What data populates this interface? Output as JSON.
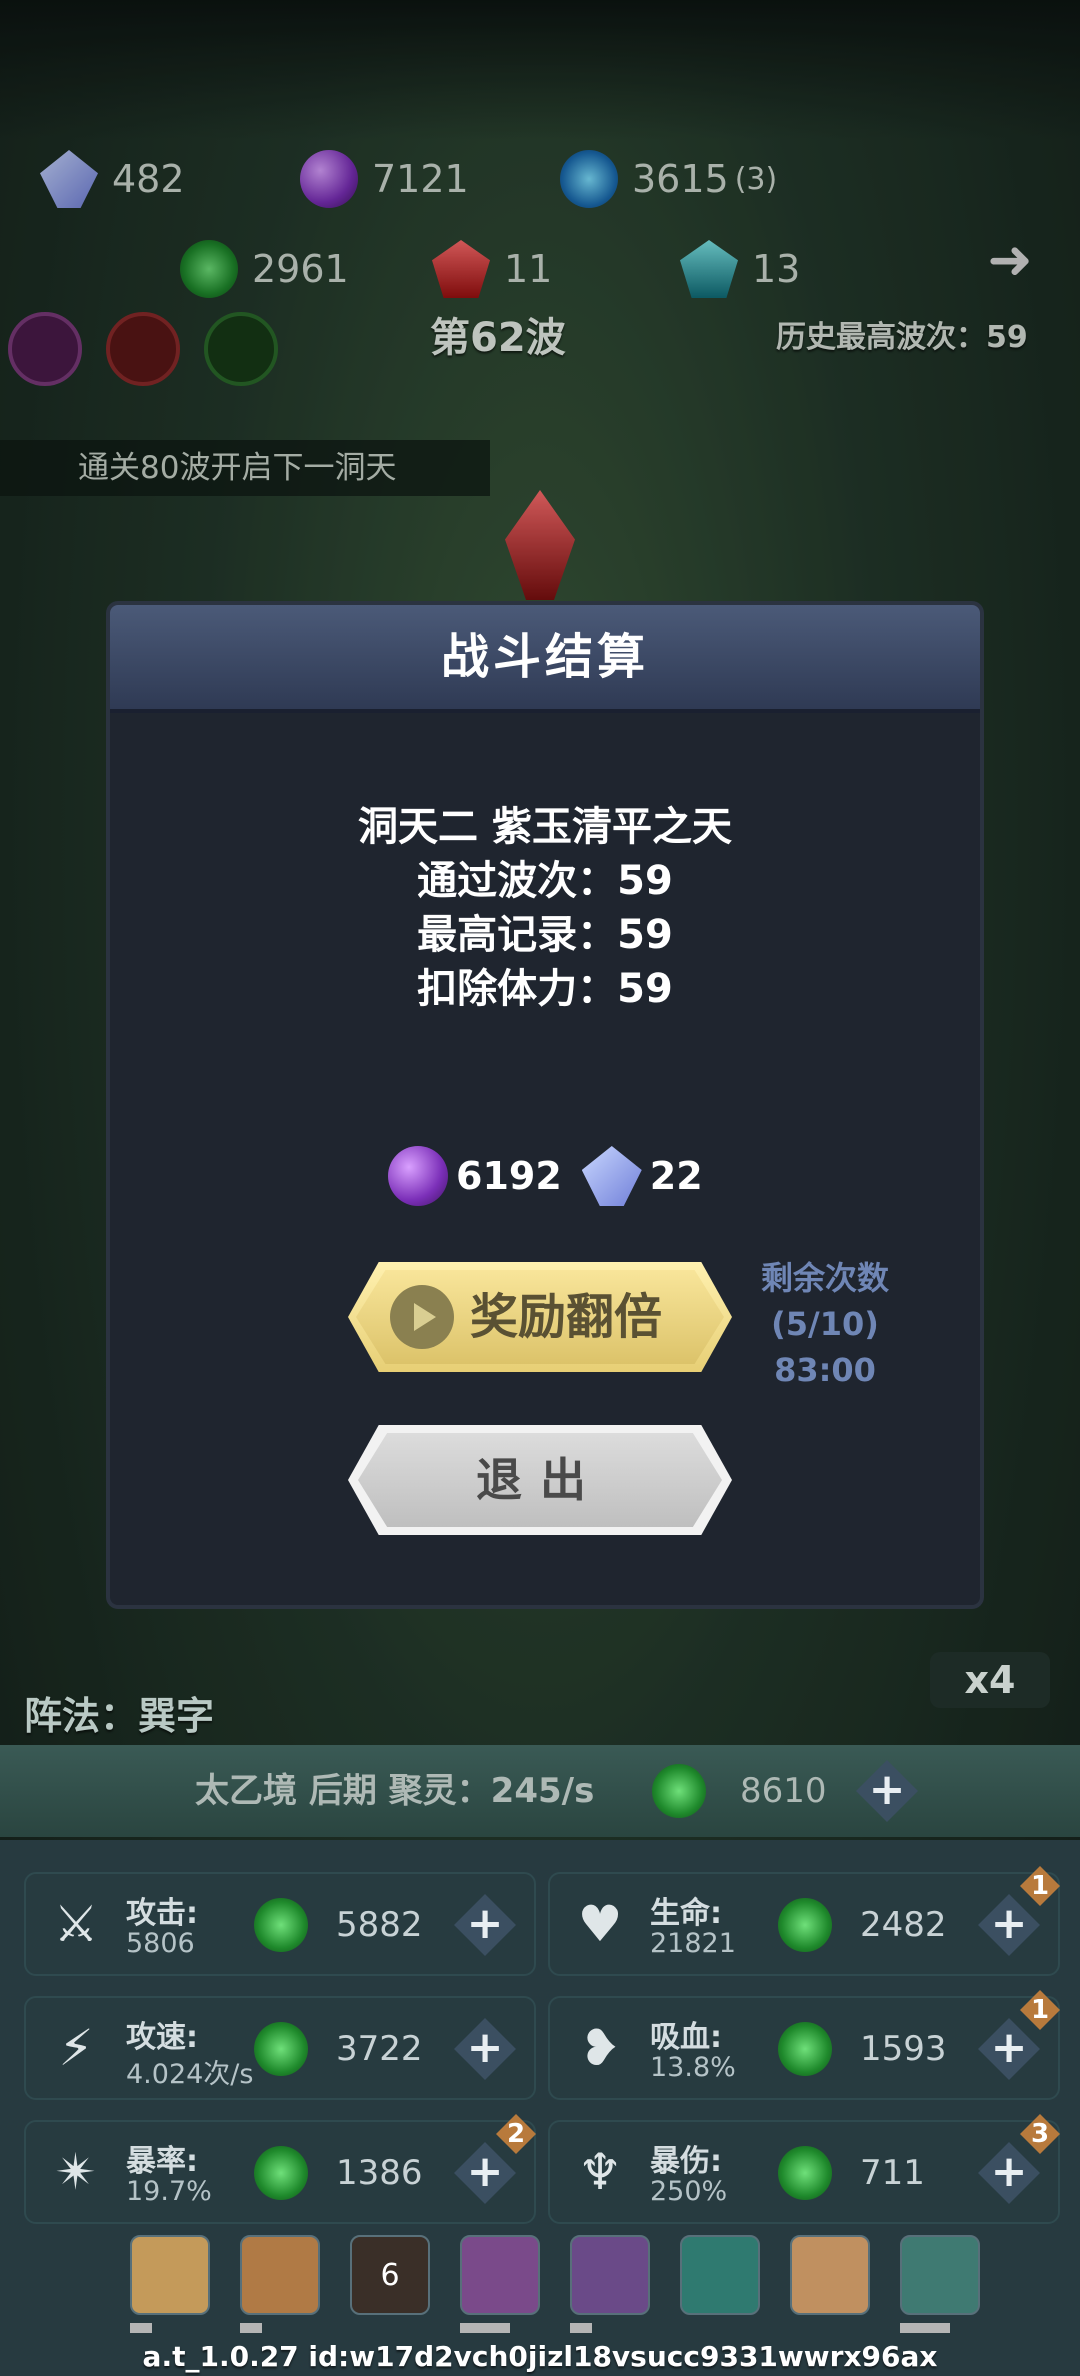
{
  "top": {
    "row1": [
      {
        "icon": "crystal-icon",
        "value": "482"
      },
      {
        "icon": "purple-orb-icon",
        "value": "7121"
      },
      {
        "icon": "lightning-orb-icon",
        "value": "3615",
        "suffix": "(3)"
      }
    ],
    "row2": [
      {
        "icon": "green-spirit-icon",
        "value": "2961"
      },
      {
        "icon": "red-gem-icon",
        "value": "11"
      },
      {
        "icon": "teal-gem-icon",
        "value": "13"
      }
    ],
    "next_arrow": "➜"
  },
  "wave": {
    "label": "第62波",
    "history": "历史最高波次：59"
  },
  "tip": "通关80波开启下一洞天",
  "dialog": {
    "title": "战斗结算",
    "lines": [
      "洞天二 紫玉清平之天",
      "通过波次：59",
      "最高记录：59",
      "扣除体力：59"
    ],
    "rewards": [
      {
        "icon": "purple-orb-icon",
        "value": "6192"
      },
      {
        "icon": "crystal-icon",
        "value": "22"
      }
    ],
    "double_label": "奖励翻倍",
    "remaining": {
      "title": "剩余次数",
      "count": "(5/10)",
      "timer": "83:00"
    },
    "exit_label": "退出"
  },
  "formation": "阵法：巽字",
  "speed": "x4",
  "realm": {
    "text": "太乙境 后期 聚灵：245/s",
    "value": "8610"
  },
  "stats": [
    {
      "name": "攻击:",
      "value": "5806",
      "cost": "5882",
      "icon": "sword-icon",
      "badge": ""
    },
    {
      "name": "生命:",
      "value": "21821",
      "cost": "2482",
      "icon": "heart-icon",
      "badge": "1"
    },
    {
      "name": "攻速:",
      "value": "4.024次/s",
      "cost": "3722",
      "icon": "attack-speed-icon",
      "badge": ""
    },
    {
      "name": "吸血:",
      "value": "13.8%",
      "cost": "1593",
      "icon": "lifesteal-icon",
      "badge": "1"
    },
    {
      "name": "暴率:",
      "value": "19.7%",
      "cost": "1386",
      "icon": "crit-rate-icon",
      "badge": "2"
    },
    {
      "name": "暴伤:",
      "value": "250%",
      "cost": "711",
      "icon": "crit-damage-icon",
      "badge": "3"
    }
  ],
  "skills": [
    "",
    "",
    "6",
    "",
    "",
    "",
    "",
    ""
  ],
  "build": "a.t_1.0.27 id:w17d2vch0jizl18vsucc9331wwrx96ax",
  "colors": {
    "accent_gold": "#efd98a",
    "dialog_bg": "#1f252f",
    "remain_text": "#6f86b5"
  }
}
